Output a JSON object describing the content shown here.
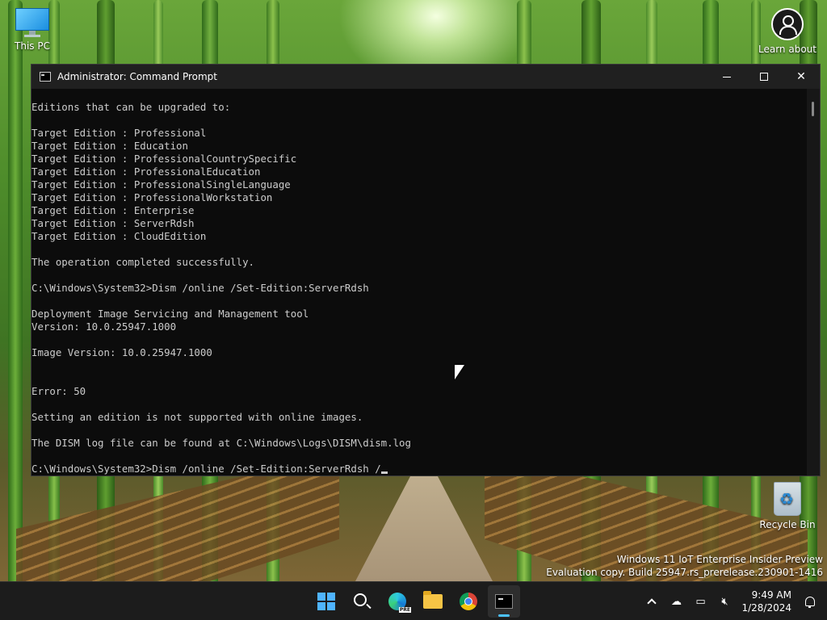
{
  "desktop": {
    "icons": [
      {
        "label": "This PC"
      },
      {
        "label": "Learn about"
      },
      {
        "label": "Recycle Bin"
      }
    ],
    "watermark": {
      "line1": "Windows 11 IoT Enterprise Insider Preview",
      "line2": "Evaluation copy. Build 25947.rs_prerelease.230901-1416"
    }
  },
  "window": {
    "title": "Administrator: Command Prompt",
    "controls": {
      "minimize": "minimize",
      "maximize": "maximize",
      "close": "✕"
    },
    "console_lines": [
      "Editions that can be upgraded to:",
      "",
      "Target Edition : Professional",
      "Target Edition : Education",
      "Target Edition : ProfessionalCountrySpecific",
      "Target Edition : ProfessionalEducation",
      "Target Edition : ProfessionalSingleLanguage",
      "Target Edition : ProfessionalWorkstation",
      "Target Edition : Enterprise",
      "Target Edition : ServerRdsh",
      "Target Edition : CloudEdition",
      "",
      "The operation completed successfully.",
      "",
      "C:\\Windows\\System32>Dism /online /Set-Edition:ServerRdsh",
      "",
      "Deployment Image Servicing and Management tool",
      "Version: 10.0.25947.1000",
      "",
      "Image Version: 10.0.25947.1000",
      "",
      "",
      "Error: 50",
      "",
      "Setting an edition is not supported with online images.",
      "",
      "The DISM log file can be found at C:\\Windows\\Logs\\DISM\\dism.log",
      "",
      "C:\\Windows\\System32>Dism /online /Set-Edition:ServerRdsh /"
    ]
  },
  "taskbar": {
    "apps": [
      {
        "icon": "windows-start-icon",
        "active": false
      },
      {
        "icon": "search-icon",
        "active": false
      },
      {
        "icon": "edge-icon",
        "active": false
      },
      {
        "icon": "file-explorer-icon",
        "active": false
      },
      {
        "icon": "chrome-icon",
        "active": false
      },
      {
        "icon": "terminal-icon",
        "active": true
      }
    ],
    "tray": {
      "time": "9:49 AM",
      "date": "1/28/2024"
    }
  },
  "colors": {
    "console_bg": "#0c0c0c",
    "console_fg": "#cccccc",
    "titlebar_bg": "#202020",
    "taskbar_bg": "#1c1c1c",
    "accent": "#4cc2ff"
  }
}
